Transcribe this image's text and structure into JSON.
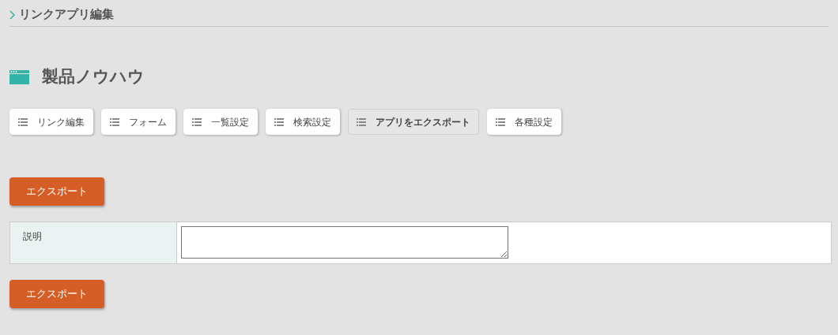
{
  "breadcrumb": {
    "label": "リンクアプリ編集"
  },
  "app": {
    "title": "製品ノウハウ"
  },
  "tabs": [
    {
      "label": "リンク編集",
      "selected": false
    },
    {
      "label": "フォーム",
      "selected": false
    },
    {
      "label": "一覧設定",
      "selected": false
    },
    {
      "label": "検索設定",
      "selected": false
    },
    {
      "label": "アプリをエクスポート",
      "selected": true
    },
    {
      "label": "各種設定",
      "selected": false
    }
  ],
  "export_button_top": "エクスポート",
  "form": {
    "rows": [
      {
        "label": "説明"
      }
    ]
  },
  "export_button_bottom": "エクスポート"
}
